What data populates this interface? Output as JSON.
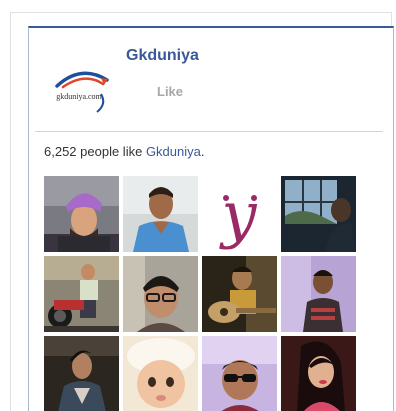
{
  "page": {
    "name": "Gkduniya",
    "logo_text": "gkduniya.com",
    "like_label": "Like"
  },
  "likes": {
    "count": "6,252",
    "text": " people like ",
    "page_link": "Gkduniya",
    "period": "."
  },
  "fans": [
    {
      "index": 1
    },
    {
      "index": 2
    },
    {
      "index": 3
    },
    {
      "index": 4
    },
    {
      "index": 5
    },
    {
      "index": 6
    },
    {
      "index": 7
    },
    {
      "index": 8
    },
    {
      "index": 9
    },
    {
      "index": 10
    },
    {
      "index": 11
    },
    {
      "index": 12
    }
  ],
  "colors": {
    "brand": "#3b5998",
    "like_gray": "#a8a8a8",
    "text": "#333333"
  }
}
